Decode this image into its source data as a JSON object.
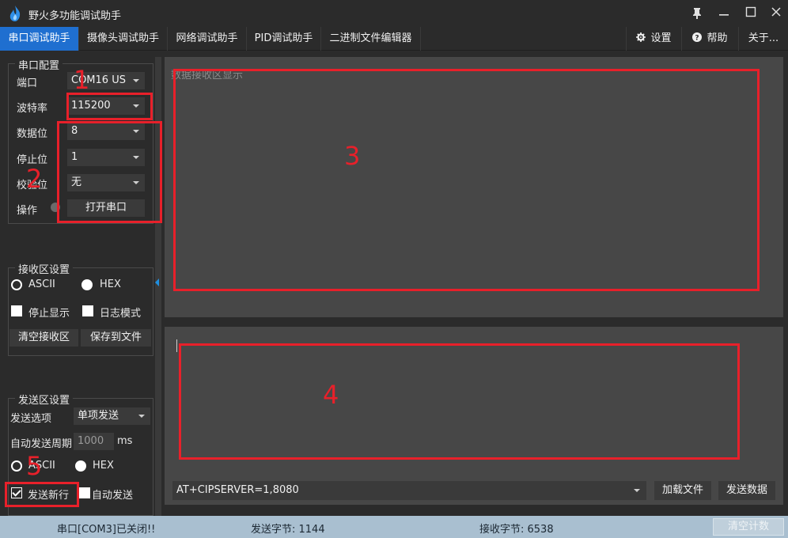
{
  "window": {
    "title": "野火多功能调试助手"
  },
  "tabs": [
    "串口调试助手",
    "摄像头调试助手",
    "网络调试助手",
    "PID调试助手",
    "二进制文件编辑器"
  ],
  "tabs_right": {
    "settings": "设置",
    "help": "帮助",
    "about": "关于..."
  },
  "serial_config": {
    "title": "串口配置",
    "port_label": "端口",
    "port_value": "COM16 US",
    "baud_label": "波特率",
    "baud_value": "115200",
    "data_label": "数据位",
    "data_value": "8",
    "stop_label": "停止位",
    "stop_value": "1",
    "parity_label": "校验位",
    "parity_value": "无",
    "op_label": "操作",
    "open_button": "打开串口"
  },
  "recv_settings": {
    "title": "接收区设置",
    "ascii": "ASCII",
    "hex": "HEX",
    "stop_display": "停止显示",
    "log_mode": "日志模式",
    "clear_button": "清空接收区",
    "save_button": "保存到文件"
  },
  "send_settings": {
    "title": "发送区设置",
    "option_label": "发送选项",
    "option_value": "单项发送",
    "period_label": "自动发送周期",
    "period_value": "1000",
    "period_unit": "ms",
    "ascii": "ASCII",
    "hex": "HEX",
    "send_newline": "发送新行",
    "auto_send": "自动发送"
  },
  "recv_area": {
    "placeholder": "数据接收区显示"
  },
  "send_area": {
    "command_value": "AT+CIPSERVER=1,8080",
    "load_file_button": "加载文件",
    "send_button": "发送数据"
  },
  "status": {
    "port_status": "串口[COM3]已关闭!!",
    "sent_bytes": "发送字节: 1144",
    "recv_bytes": "接收字节: 6538",
    "clear_count_button": "清空计数"
  },
  "annotations": [
    "1",
    "2",
    "3",
    "4",
    "5"
  ],
  "colors": {
    "accent": "#1f6fd0",
    "annotation": "#e8202a",
    "statusbar": "#a9bfd0"
  }
}
